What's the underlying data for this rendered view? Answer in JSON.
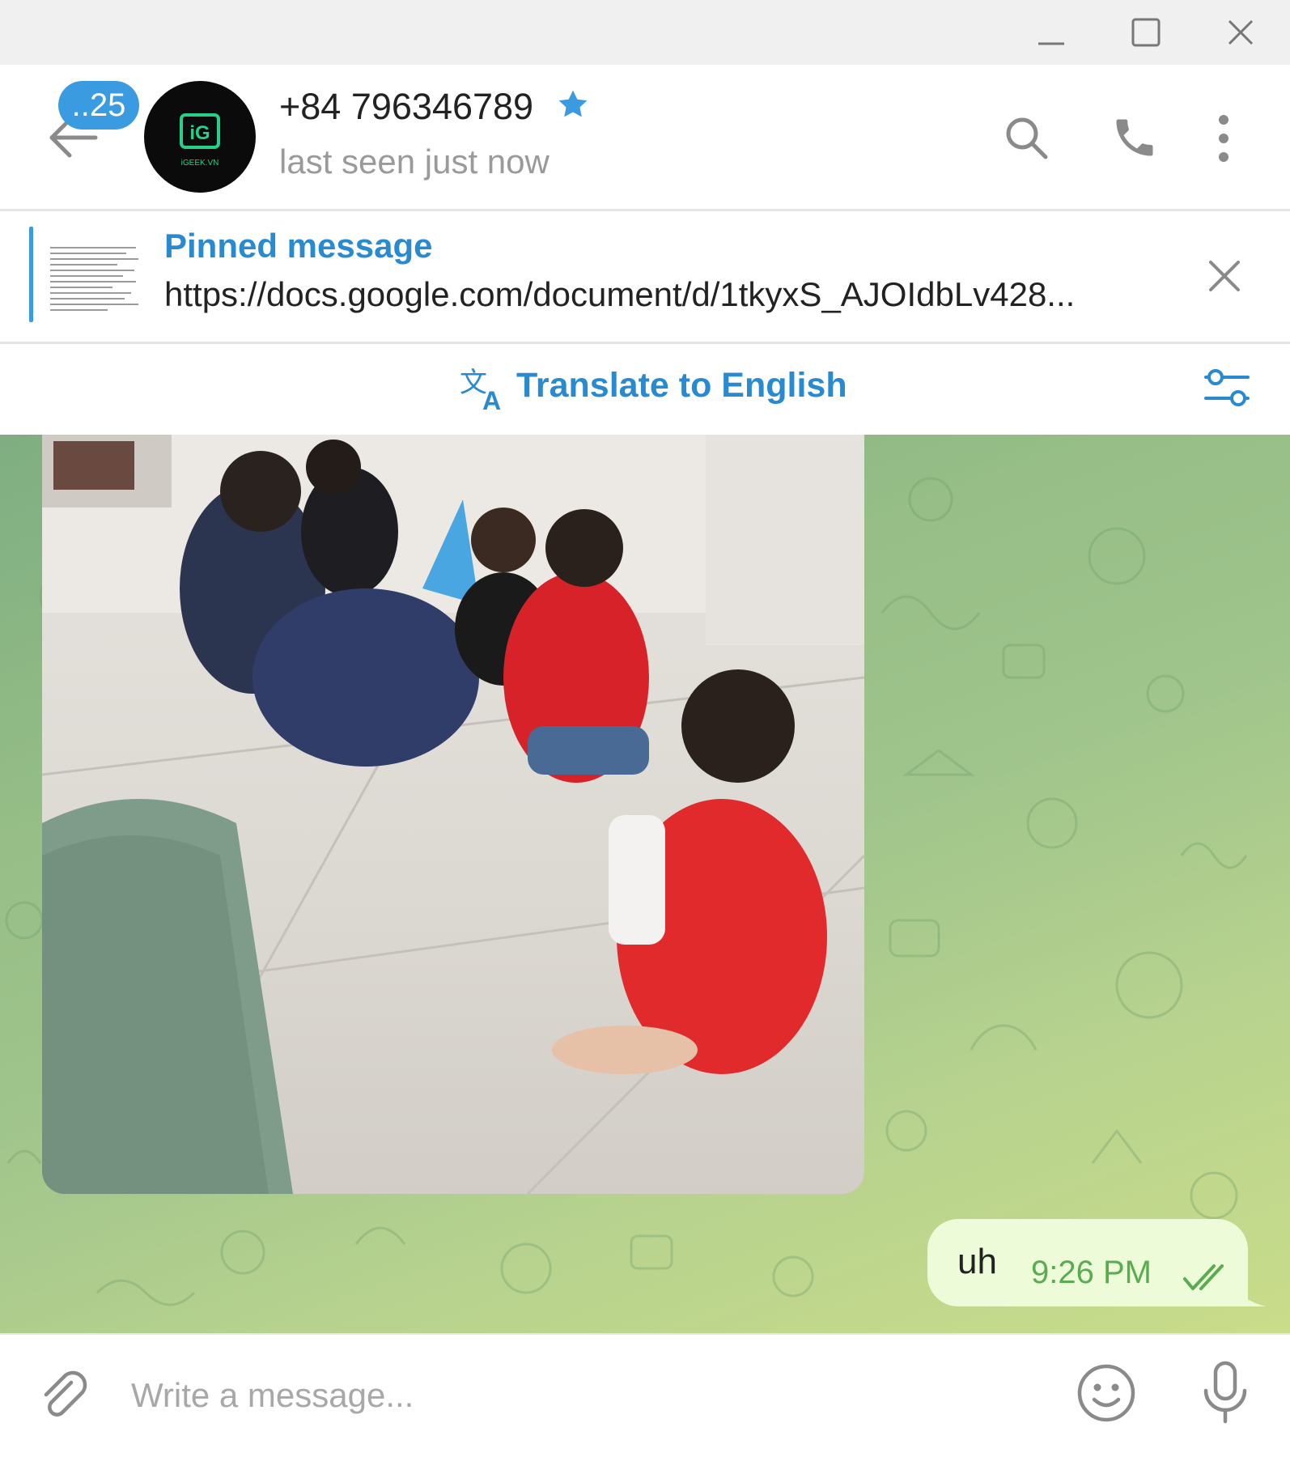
{
  "window": {
    "controls": [
      "minimize-icon",
      "maximize-icon",
      "close-icon"
    ]
  },
  "header": {
    "unread_badge": "..25",
    "contact_name": "+84 796346789",
    "last_seen": "last seen just now",
    "avatar_logo_text": "iGEEK.VN",
    "icons": [
      "back-arrow-icon",
      "star-icon",
      "search-icon",
      "phone-icon",
      "more-vertical-icon"
    ]
  },
  "pinned": {
    "title": "Pinned message",
    "text": "https://docs.google.com/document/d/1tkyxS_AJOIdbLv428..."
  },
  "translate": {
    "label": "Translate to English"
  },
  "messages": [
    {
      "type": "photo",
      "incoming": true
    },
    {
      "type": "text",
      "text": "uh",
      "time": "9:26 PM",
      "status": "read",
      "outgoing": true
    }
  ],
  "composer": {
    "placeholder": "Write a message..."
  },
  "colors": {
    "accent": "#3a9be0",
    "link_blue": "#2a8ad0",
    "outgoing_bubble": "#eefbd8",
    "time_green": "#5aab52",
    "chat_bg": "#9fc48c"
  }
}
